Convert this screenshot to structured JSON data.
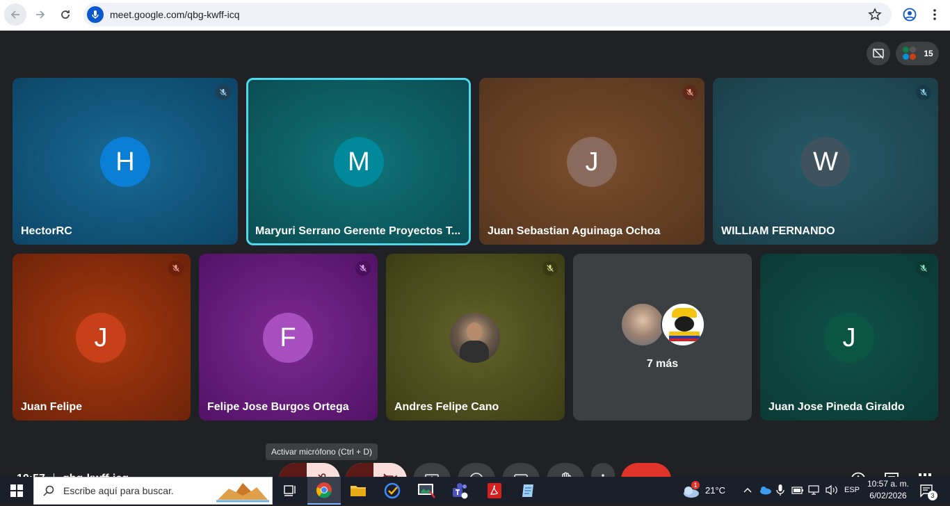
{
  "browser": {
    "url": "meet.google.com/qbg-kwff-icq"
  },
  "meeting": {
    "participant_count": "15",
    "time": "10:57",
    "code": "qbg-kwff-icq",
    "tooltip": "Activar micrófono (Ctrl + D)",
    "more_label": "7 más"
  },
  "tiles": [
    {
      "name": "HectorRC",
      "initial": "H",
      "avatar_color": "#0b7fd6",
      "bg": "#0e4f73"
    },
    {
      "name": "Maryuri Serrano Gerente Proyectos T...",
      "initial": "M",
      "avatar_color": "#00899b",
      "bg": "#0c5a5c"
    },
    {
      "name": "Juan Sebastian Aguinaga Ochoa",
      "initial": "J",
      "avatar_color": "#8a6a5d",
      "bg": "#5e3b22"
    },
    {
      "name": "WILLIAM FERNANDO",
      "initial": "W",
      "avatar_color": "#3f535e",
      "bg": "#1f4552"
    },
    {
      "name": "Juan Felipe",
      "initial": "J",
      "avatar_color": "#c8401a",
      "bg": "#7d2a0e"
    },
    {
      "name": "Felipe Jose Burgos Ortega",
      "initial": "F",
      "avatar_color": "#a84fbf",
      "bg": "#5d1a72"
    },
    {
      "name": "Andres Felipe Cano",
      "initial": "",
      "avatar_color": "#555",
      "bg": "#4a4a1c"
    },
    {
      "name": "Juan Jose Pineda Giraldo",
      "initial": "J",
      "avatar_color": "#0c5544",
      "bg": "#0d3f3a"
    }
  ],
  "taskbar": {
    "search_placeholder": "Escribe aquí para buscar.",
    "temperature": "21°C",
    "weather_badge": "1",
    "language": "ESP",
    "clock_time": "10:57 a. m.",
    "clock_date": "6/02/2026",
    "notification_count": "3"
  },
  "colors": {
    "end_call": "#e0342b",
    "muted_bg": "#f9dedc",
    "muted_dark": "#5c1a16",
    "highlight_border": "#4fd8eb"
  }
}
